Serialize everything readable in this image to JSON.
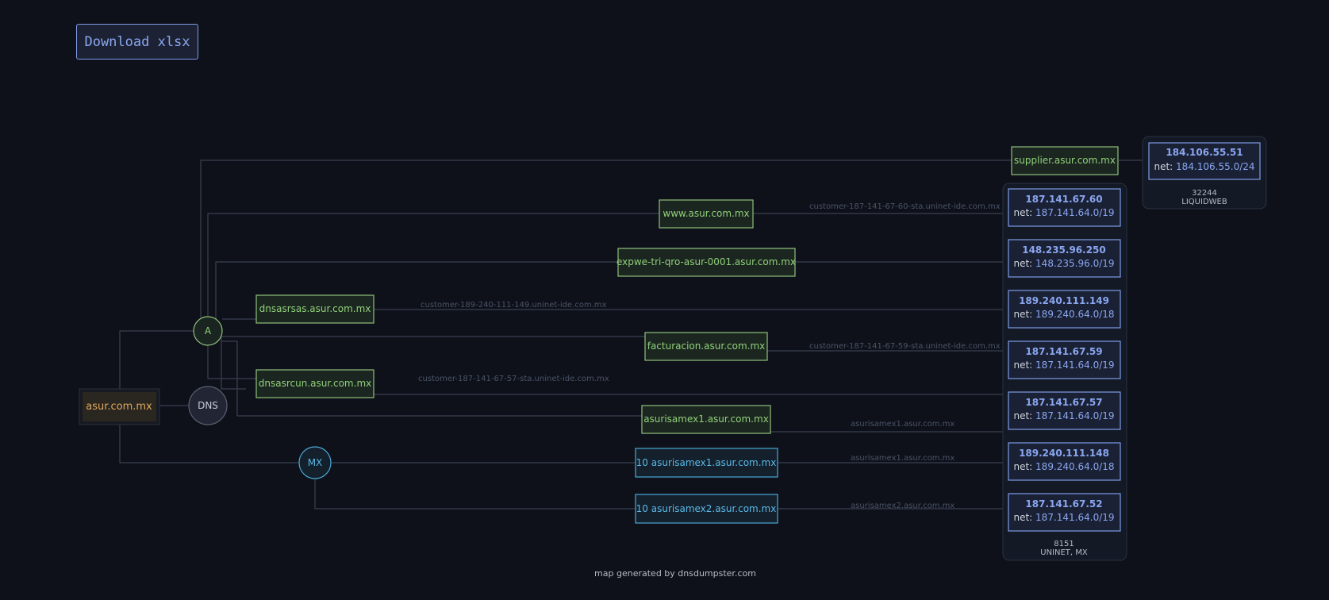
{
  "toolbar": {
    "download_label": "Download xlsx"
  },
  "colors": {
    "background": "#0e111a",
    "domain_fill": "#2a2620",
    "domain_text": "#e0a860",
    "a_record_stroke": "#8fc07a",
    "a_record_text": "#8fd07a",
    "a_record_fill": "#1c2620",
    "mx_stroke": "#4aa8d8",
    "mx_text": "#5ab8e8",
    "mx_fill": "#14202c",
    "ip_stroke": "#7f9be6",
    "ip_text": "#8aa6f0",
    "ip_fill": "#1a2135",
    "ptr_text": "#4a5366"
  },
  "root": {
    "label": "asur.com.mx"
  },
  "hubs": {
    "a": "A",
    "dns": "DNS",
    "mx": "MX"
  },
  "hosts": {
    "supplier": "supplier.asur.com.mx",
    "www": "www.asur.com.mx",
    "expwe": "expwe-tri-qro-asur-0001.asur.com.mx",
    "dnsasrsas": "dnsasrsas.asur.com.mx",
    "facturacion": "facturacion.asur.com.mx",
    "dnsasrcun": "dnsasrcun.asur.com.mx",
    "asurisamex1": "asurisamex1.asur.com.mx"
  },
  "mx_hosts": {
    "mx1": "10 asurisamex1.asur.com.mx",
    "mx2": "10 asurisamex2.asur.com.mx"
  },
  "ptr": {
    "www": "customer-187-141-67-60-sta.uninet-ide.com.mx",
    "dnsasrsas": "customer-189-240-111-149.uninet-ide.com.mx",
    "facturacion": "customer-187-141-67-59-sta.uninet-ide.com.mx",
    "dnsasrcun": "customer-187-141-67-57-sta.uninet-ide.com.mx",
    "asurisamex1": "asurisamex1.asur.com.mx",
    "mx1": "asurisamex1.asur.com.mx",
    "mx2": "asurisamex2.asur.com.mx"
  },
  "ips": {
    "ip1": {
      "ip": "184.106.55.51",
      "net_prefix": "net: ",
      "net": "184.106.55.0/24"
    },
    "ip2": {
      "ip": "187.141.67.60",
      "net_prefix": "net: ",
      "net": "187.141.64.0/19"
    },
    "ip3": {
      "ip": "148.235.96.250",
      "net_prefix": "net: ",
      "net": "148.235.96.0/19"
    },
    "ip4": {
      "ip": "189.240.111.149",
      "net_prefix": "net: ",
      "net": "189.240.64.0/18"
    },
    "ip5": {
      "ip": "187.141.67.59",
      "net_prefix": "net: ",
      "net": "187.141.64.0/19"
    },
    "ip6": {
      "ip": "187.141.67.57",
      "net_prefix": "net: ",
      "net": "187.141.64.0/19"
    },
    "ip7": {
      "ip": "189.240.111.148",
      "net_prefix": "net: ",
      "net": "189.240.64.0/18"
    },
    "ip8": {
      "ip": "187.141.67.52",
      "net_prefix": "net: ",
      "net": "187.141.64.0/19"
    }
  },
  "asns": {
    "liquidweb": {
      "asn": "32244",
      "name": "LIQUIDWEB"
    },
    "uninet": {
      "asn": "8151",
      "name": "UNINET, MX"
    }
  },
  "footer": "map generated by dnsdumpster.com"
}
